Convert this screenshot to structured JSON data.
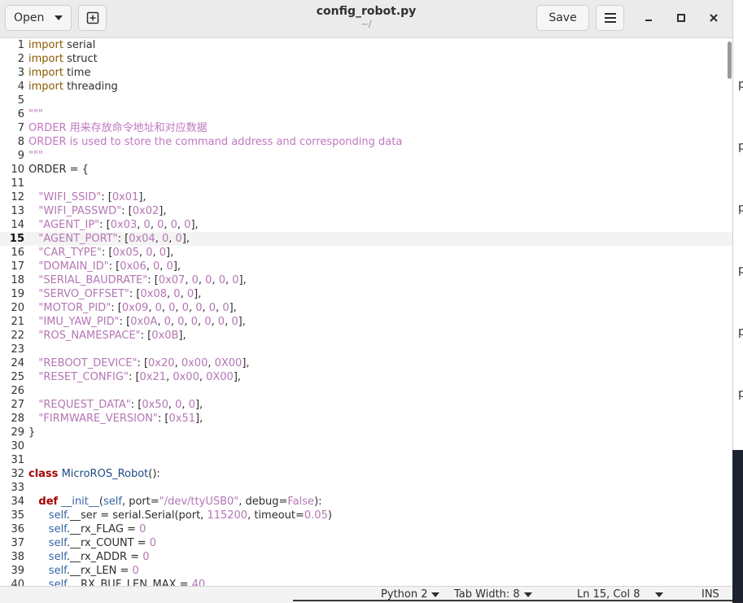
{
  "header": {
    "open_label": "Open",
    "title": "config_robot.py",
    "subtitle": "~/",
    "save_label": "Save"
  },
  "editor": {
    "current_line": 15,
    "lines": [
      [
        [
          "import",
          "kw"
        ],
        [
          " serial",
          ""
        ]
      ],
      [
        [
          "import",
          "kw"
        ],
        [
          " struct",
          ""
        ]
      ],
      [
        [
          "import",
          "kw"
        ],
        [
          " time",
          ""
        ]
      ],
      [
        [
          "import",
          "kw"
        ],
        [
          " threading",
          ""
        ]
      ],
      [],
      [
        [
          "\"\"\"",
          "doc"
        ]
      ],
      [
        [
          "ORDER 用来存放命令地址和对应数据",
          "doc"
        ]
      ],
      [
        [
          "ORDER is used to store the command address and corresponding data",
          "doc"
        ]
      ],
      [
        [
          "\"\"\"",
          "doc"
        ]
      ],
      [
        [
          "ORDER = {",
          ""
        ]
      ],
      [],
      [
        [
          "   ",
          ""
        ],
        [
          "\"WIFI_SSID\"",
          "str"
        ],
        [
          ": [",
          ""
        ],
        [
          "0x01",
          "num"
        ],
        [
          "],",
          ""
        ]
      ],
      [
        [
          "   ",
          ""
        ],
        [
          "\"WIFI_PASSWD\"",
          "str"
        ],
        [
          ": [",
          ""
        ],
        [
          "0x02",
          "num"
        ],
        [
          "],",
          ""
        ]
      ],
      [
        [
          "   ",
          ""
        ],
        [
          "\"AGENT_IP\"",
          "str"
        ],
        [
          ": [",
          ""
        ],
        [
          "0x03",
          "num"
        ],
        [
          ", ",
          ""
        ],
        [
          "0",
          "num"
        ],
        [
          ", ",
          ""
        ],
        [
          "0",
          "num"
        ],
        [
          ", ",
          ""
        ],
        [
          "0",
          "num"
        ],
        [
          ", ",
          ""
        ],
        [
          "0",
          "num"
        ],
        [
          "],",
          ""
        ]
      ],
      [
        [
          "   ",
          ""
        ],
        [
          "\"AGENT_PORT\"",
          "str"
        ],
        [
          ": [",
          ""
        ],
        [
          "0x04",
          "num"
        ],
        [
          ", ",
          ""
        ],
        [
          "0",
          "num"
        ],
        [
          ", ",
          ""
        ],
        [
          "0",
          "num"
        ],
        [
          "],",
          ""
        ]
      ],
      [
        [
          "   ",
          ""
        ],
        [
          "\"CAR_TYPE\"",
          "str"
        ],
        [
          ": [",
          ""
        ],
        [
          "0x05",
          "num"
        ],
        [
          ", ",
          ""
        ],
        [
          "0",
          "num"
        ],
        [
          ", ",
          ""
        ],
        [
          "0",
          "num"
        ],
        [
          "],",
          ""
        ]
      ],
      [
        [
          "   ",
          ""
        ],
        [
          "\"DOMAIN_ID\"",
          "str"
        ],
        [
          ": [",
          ""
        ],
        [
          "0x06",
          "num"
        ],
        [
          ", ",
          ""
        ],
        [
          "0",
          "num"
        ],
        [
          ", ",
          ""
        ],
        [
          "0",
          "num"
        ],
        [
          "],",
          ""
        ]
      ],
      [
        [
          "   ",
          ""
        ],
        [
          "\"SERIAL_BAUDRATE\"",
          "str"
        ],
        [
          ": [",
          ""
        ],
        [
          "0x07",
          "num"
        ],
        [
          ", ",
          ""
        ],
        [
          "0",
          "num"
        ],
        [
          ", ",
          ""
        ],
        [
          "0",
          "num"
        ],
        [
          ", ",
          ""
        ],
        [
          "0",
          "num"
        ],
        [
          ", ",
          ""
        ],
        [
          "0",
          "num"
        ],
        [
          "],",
          ""
        ]
      ],
      [
        [
          "   ",
          ""
        ],
        [
          "\"SERVO_OFFSET\"",
          "str"
        ],
        [
          ": [",
          ""
        ],
        [
          "0x08",
          "num"
        ],
        [
          ", ",
          ""
        ],
        [
          "0",
          "num"
        ],
        [
          ", ",
          ""
        ],
        [
          "0",
          "num"
        ],
        [
          "],",
          ""
        ]
      ],
      [
        [
          "   ",
          ""
        ],
        [
          "\"MOTOR_PID\"",
          "str"
        ],
        [
          ": [",
          ""
        ],
        [
          "0x09",
          "num"
        ],
        [
          ", ",
          ""
        ],
        [
          "0",
          "num"
        ],
        [
          ", ",
          ""
        ],
        [
          "0",
          "num"
        ],
        [
          ", ",
          ""
        ],
        [
          "0",
          "num"
        ],
        [
          ", ",
          ""
        ],
        [
          "0",
          "num"
        ],
        [
          ", ",
          ""
        ],
        [
          "0",
          "num"
        ],
        [
          ", ",
          ""
        ],
        [
          "0",
          "num"
        ],
        [
          "],",
          ""
        ]
      ],
      [
        [
          "   ",
          ""
        ],
        [
          "\"IMU_YAW_PID\"",
          "str"
        ],
        [
          ": [",
          ""
        ],
        [
          "0x0A",
          "num"
        ],
        [
          ", ",
          ""
        ],
        [
          "0",
          "num"
        ],
        [
          ", ",
          ""
        ],
        [
          "0",
          "num"
        ],
        [
          ", ",
          ""
        ],
        [
          "0",
          "num"
        ],
        [
          ", ",
          ""
        ],
        [
          "0",
          "num"
        ],
        [
          ", ",
          ""
        ],
        [
          "0",
          "num"
        ],
        [
          ", ",
          ""
        ],
        [
          "0",
          "num"
        ],
        [
          "],",
          ""
        ]
      ],
      [
        [
          "   ",
          ""
        ],
        [
          "\"ROS_NAMESPACE\"",
          "str"
        ],
        [
          ": [",
          ""
        ],
        [
          "0x0B",
          "num"
        ],
        [
          "],",
          ""
        ]
      ],
      [],
      [
        [
          "   ",
          ""
        ],
        [
          "\"REBOOT_DEVICE\"",
          "str"
        ],
        [
          ": [",
          ""
        ],
        [
          "0x20",
          "num"
        ],
        [
          ", ",
          ""
        ],
        [
          "0x00",
          "num"
        ],
        [
          ", ",
          ""
        ],
        [
          "0X00",
          "num"
        ],
        [
          "],",
          ""
        ]
      ],
      [
        [
          "   ",
          ""
        ],
        [
          "\"RESET_CONFIG\"",
          "str"
        ],
        [
          ": [",
          ""
        ],
        [
          "0x21",
          "num"
        ],
        [
          ", ",
          ""
        ],
        [
          "0x00",
          "num"
        ],
        [
          ", ",
          ""
        ],
        [
          "0X00",
          "num"
        ],
        [
          "],",
          ""
        ]
      ],
      [],
      [
        [
          "   ",
          ""
        ],
        [
          "\"REQUEST_DATA\"",
          "str"
        ],
        [
          ": [",
          ""
        ],
        [
          "0x50",
          "num"
        ],
        [
          ", ",
          ""
        ],
        [
          "0",
          "num"
        ],
        [
          ", ",
          ""
        ],
        [
          "0",
          "num"
        ],
        [
          "],",
          ""
        ]
      ],
      [
        [
          "   ",
          ""
        ],
        [
          "\"FIRMWARE_VERSION\"",
          "str"
        ],
        [
          ": [",
          ""
        ],
        [
          "0x51",
          "num"
        ],
        [
          "],",
          ""
        ]
      ],
      [
        [
          "}",
          ""
        ]
      ],
      [],
      [],
      [
        [
          "class",
          "def"
        ],
        [
          " ",
          ""
        ],
        [
          "MicroROS_Robot",
          "cls"
        ],
        [
          "():",
          ""
        ]
      ],
      [],
      [
        [
          "   ",
          ""
        ],
        [
          "def",
          "def"
        ],
        [
          " ",
          ""
        ],
        [
          "__init__",
          "bi"
        ],
        [
          "(",
          ""
        ],
        [
          "self",
          "self"
        ],
        [
          ", port=",
          ""
        ],
        [
          "\"/dev/ttyUSB0\"",
          "str"
        ],
        [
          ", debug=",
          ""
        ],
        [
          "False",
          "num"
        ],
        [
          "):",
          ""
        ]
      ],
      [
        [
          "      ",
          ""
        ],
        [
          "self",
          "self"
        ],
        [
          ".__ser = serial.Serial(port, ",
          ""
        ],
        [
          "115200",
          "num"
        ],
        [
          ", timeout=",
          ""
        ],
        [
          "0.05",
          "num"
        ],
        [
          ")",
          ""
        ]
      ],
      [
        [
          "      ",
          ""
        ],
        [
          "self",
          "self"
        ],
        [
          ".__rx_FLAG = ",
          ""
        ],
        [
          "0",
          "num"
        ]
      ],
      [
        [
          "      ",
          ""
        ],
        [
          "self",
          "self"
        ],
        [
          ".__rx_COUNT = ",
          ""
        ],
        [
          "0",
          "num"
        ]
      ],
      [
        [
          "      ",
          ""
        ],
        [
          "self",
          "self"
        ],
        [
          ".__rx_ADDR = ",
          ""
        ],
        [
          "0",
          "num"
        ]
      ],
      [
        [
          "      ",
          ""
        ],
        [
          "self",
          "self"
        ],
        [
          ".__rx_LEN = ",
          ""
        ],
        [
          "0",
          "num"
        ]
      ],
      [
        [
          "      ",
          ""
        ],
        [
          "self",
          "self"
        ],
        [
          ".__RX_BUF_LEN_MAX = ",
          ""
        ],
        [
          "40",
          "num"
        ]
      ]
    ]
  },
  "statusbar": {
    "language": "Python 2",
    "tab_width": "Tab Width: 8",
    "position": "Ln 15, Col 8",
    "mode": "INS"
  },
  "background_window": {
    "letters": [
      "p",
      "p",
      "p",
      "p",
      "p",
      "p"
    ]
  }
}
